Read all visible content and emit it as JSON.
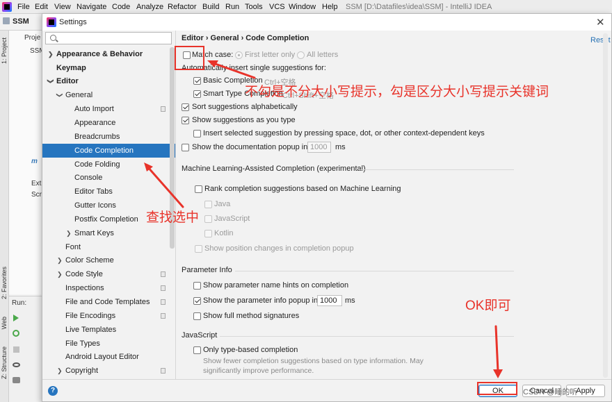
{
  "ide": {
    "menu": [
      "File",
      "Edit",
      "View",
      "Navigate",
      "Code",
      "Analyze",
      "Refactor",
      "Build",
      "Run",
      "Tools",
      "VCS",
      "Window",
      "Help"
    ],
    "title": "SSM [D:\\Datafiles\\idea\\SSM] - IntelliJ IDEA",
    "nav_label": "SSM",
    "project_tab": "Proje",
    "project_items": [
      "SSM",
      "",
      "",
      "",
      "m",
      "Ext",
      "Scr"
    ],
    "run_label": "Run:",
    "side_labels": [
      "1: Project",
      "2: Favorites",
      "Web",
      "Z: Structure"
    ]
  },
  "dialog": {
    "title": "Settings",
    "close": "✕",
    "search_placeholder": ""
  },
  "sidebar": {
    "items": [
      {
        "label": "Appearance & Behavior"
      },
      {
        "label": "Keymap"
      },
      {
        "label": "Editor"
      },
      {
        "label": "General"
      },
      {
        "label": "Auto Import"
      },
      {
        "label": "Appearance"
      },
      {
        "label": "Breadcrumbs"
      },
      {
        "label": "Code Completion"
      },
      {
        "label": "Code Folding"
      },
      {
        "label": "Console"
      },
      {
        "label": "Editor Tabs"
      },
      {
        "label": "Gutter Icons"
      },
      {
        "label": "Postfix Completion"
      },
      {
        "label": "Smart Keys"
      },
      {
        "label": "Font"
      },
      {
        "label": "Color Scheme"
      },
      {
        "label": "Code Style"
      },
      {
        "label": "Inspections"
      },
      {
        "label": "File and Code Templates"
      },
      {
        "label": "File Encodings"
      },
      {
        "label": "Live Templates"
      },
      {
        "label": "File Types"
      },
      {
        "label": "Android Layout Editor"
      },
      {
        "label": "Copyright"
      }
    ]
  },
  "content": {
    "breadcrumb": "Editor  ›  General  ›  Code Completion",
    "reset": "Reset",
    "match_case": "Match case:",
    "radio_first": "First letter only",
    "radio_all": "All letters",
    "auto_insert": "Automatically insert single suggestions for:",
    "basic_completion": "Basic Completion",
    "basic_shortcut": "Ctrl+空格",
    "smart_completion": "Smart Type Completion",
    "smart_shortcut": "Ctrl+Shift+空格",
    "sort_alpha": "Sort suggestions alphabetically",
    "show_as_type": "Show suggestions as you type",
    "insert_selected": "Insert selected suggestion by pressing space, dot, or other context-dependent keys",
    "doc_popup": "Show the documentation popup in",
    "doc_ms_value": "1000",
    "ms": "ms",
    "ml_title": "Machine Learning-Assisted Completion (experimental)",
    "ml_rank": "Rank completion suggestions based on Machine Learning",
    "ml_java": "Java",
    "ml_js": "JavaScript",
    "ml_kotlin": "Kotlin",
    "ml_position": "Show position changes in completion popup",
    "param_title": "Parameter Info",
    "param_hints": "Show parameter name hints on completion",
    "param_popup": "Show the parameter info popup in",
    "param_ms_value": "1000",
    "param_full": "Show full method signatures",
    "js_title": "JavaScript",
    "js_type_based": "Only type-based completion",
    "js_desc": "Show fewer completion suggestions based on type information. May significantly improve performance."
  },
  "buttons": {
    "help": "?",
    "ok": "OK",
    "cancel": "Cancel",
    "apply": "Apply"
  },
  "annotations": {
    "note_case": "不勾是不分大小写提示，勾是区分大小写提示关键词",
    "note_find": "查找选中",
    "note_ok": "OK即可",
    "color": "#e8332a"
  },
  "watermark": "CSDN @睡的听",
  "colors": {
    "selection": "#2675bf",
    "link": "#2470b3"
  }
}
